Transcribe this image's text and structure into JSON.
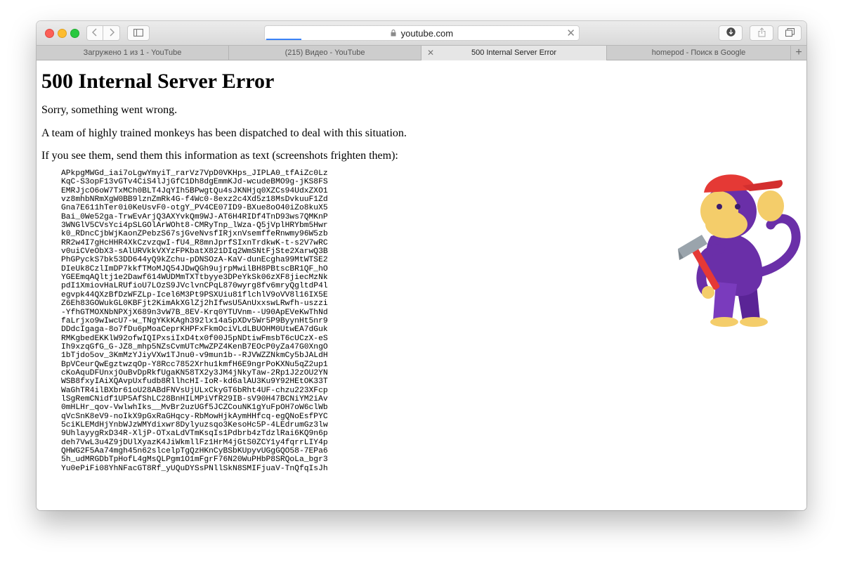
{
  "browser": {
    "address_url": "youtube.com",
    "tabs": [
      {
        "label": "Загружено 1 из 1 - YouTube",
        "active": false
      },
      {
        "label": "(215) Видео - YouTube",
        "active": false
      },
      {
        "label": "500 Internal Server Error",
        "active": true
      },
      {
        "label": "homepod - Поиск в Google",
        "active": false
      }
    ]
  },
  "page": {
    "title": "500 Internal Server Error",
    "sorry": "Sorry, something went wrong.",
    "monkeys": "A team of highly trained monkeys has been dispatched to deal with this situation.",
    "instruction": "If you see them, send them this information as text (screenshots frighten them):",
    "error_lines": [
      "APkpgMWGd_iai7oLgwYmyiT_rarVz7VpD0VKHps_JIPLA0_tfAiZc0Lz",
      "KqC-S3opF13vGTv4CiS4lJjGfC1Dh8dgEmmKJd-wcudeBMO9g-jKS8FS",
      "EMRJjcO6oW7TxMCh0BLT4JqYIh5BPwgtQu4sJKNHjq0XZCs94UdxZXO1",
      "vz8mhbNRmXgW0BB9lznZmRk4G-f4Wc0-8exz2c4Xd5z18MsDvkuuF1Zd",
      "Gna7E611hTer0i0KeUsvF0-otgY_PV4CE07ID9-BXue8oO40iZo8kuX5",
      "Bai_0We52ga-TrwEvArjQ3AXYvkQm9WJ-AT6H4RIDf4TnD93ws7QMKnP",
      "3WNGlV5CVsYci4pSLGOlArWOht8-CMRyTnp_lWza-Q5jVplHRYbm5Hwr",
      "k0_RDncCjbWjKaonZPebzS67sjGveNvsfIRjxnVsemffeRnwmy96W5zb",
      "RR2w4I7gHcHHR4XkCzvzqwI-fU4_R8mnJprfSIxnTrdkwK-t-s2V7wRC",
      "v0uiCVeObX3-sAlURVkkVXYzFPKbatX821DIq2WmSNtFjSte2XarwQ3B",
      "PhGPyckS7bk53DD644yQ9kZchu-pDNSOzA-KaV-dunEcgha99MtWTSE2",
      "DIeUk8CzlImDP7kkfTMoMJQ54JDwQGh9ujrpMwilBH8PBtscBR1QF_hO",
      "YGEEmqAQltj1e2Dawf614WUDMmTXTtbyye3DPeYkSk06zXF8jiecMzNk",
      "pdI1XmiovHaLRUfioU7LOzS9JVclvnCPqL870wyrg8fv6mryQgltdP4l",
      "egvpk44QXzBfDzWFZLp-Icel6M3Pt9PSXUiu81flchlV9oVV8l16IX5E",
      "Z6Eh83GOWukGL0KBFjt2KimAkXGlZj2hIfwsU5AnUxxswLRwfh-uszzi",
      "-YfhGTMOXNbNPXjX689n3vW7B_8EV-Krq0YTUVnm--U90ApEVeKwThNd",
      "faLrjxo9wIwcU7-w_TNgYKkKAgh392lx14a5pXDv5Wr5P9ByynHt5nr9",
      "DDdcIgaga-8o7fDu6pMoaCeprKHPFxFkmOciVLdLBUOHM0UtwEA7dGuk",
      "RMKgbedEKKlW92ofwIQIPxsiIxD4tx0f00J5pNDtiwFmsbT6cUCzX-eS",
      "Ih9xzqGfG_G-JZ8_mhp5NZsCvmUTcMwZPZ4KenB7EOcP0yZa47G0XngO",
      "1bTjdo5ov_3KmMzYJiyVXw1TJnu0-v9mun1b--RJVWZZNkmCy5bJALdH",
      "BpVCeurQwEgztwzqOp-Y8Rcc7852Xrhu1kmfH6E9ngrPoKXNu5qZ2up1",
      "cKoAquDFUnxjOuBvDpRkfUgaKN58TX2y3JM4jNkyTaw-2Rp1J2zOU2YN",
      "WSB8fxyIAiXQAvpUxfudb8RllhcHI-IoR-kd6alAU3Ku9Y92HEtOK33T",
      "WaGhTR4ilBXbr61oU28ABdFNVsUjULxCkyGT6bRht4UF-chzu223XFcp",
      "lSgRemCNidf1UP5AfShLC28BnHILMPiVfR29IB-sV90H47BCNiYM2iAv",
      "0mHLHr_qov-VwlwhIks__MvBr2uzUGf5JCZCouNK1gYuFpOH7oW6clWb",
      "qVcSnK8eV9-noIkX9pGxRaGHqcy-RbMowHjkAymHHfcq-egQNoEsfPYC",
      "5ciKLEMdHjYnbWJzWMYdixwr8Dylyuzsqo3KesoHc5P-4LEdrumGz3lw",
      "9UhlayygRxD34R-XljP-OTxaLdVTmKsqIs1Pdbrb4zTdzlRai6KQ9n6p",
      "deh7VwL3u4Z9jDUlXyazK4JiWkmllFz1HrM4jGtS0ZCY1y4fqrrLIY4p",
      "QHWG2F5Aa74mgh45n62slcelpTgQzHKnCyBSbKUpyvUGgGQO58-7EPa6",
      "5h_udMRGDbTpHofL4gMsQLPgm1O1mFgrF76N20WuPHbP8SRQoLa_bgr3",
      "Yu0ePiFi08YhNFacGT8Rf_yUQuDYSsPNllSkN8SMIFjuaV-TnQfqIsJh"
    ]
  },
  "icons": [
    "back-icon",
    "forward-icon",
    "sidebar-icon",
    "lock-icon",
    "close-icon",
    "downloads-icon",
    "share-icon",
    "tabs-overview-icon",
    "new-tab-icon",
    "monkey-illustration"
  ],
  "colors": {
    "page_bg": "#ffffff",
    "progress": "#3b82f6",
    "monkey_purple": "#6a2fa8",
    "monkey_face": "#f4cd6a",
    "hat_red": "#e53935"
  }
}
